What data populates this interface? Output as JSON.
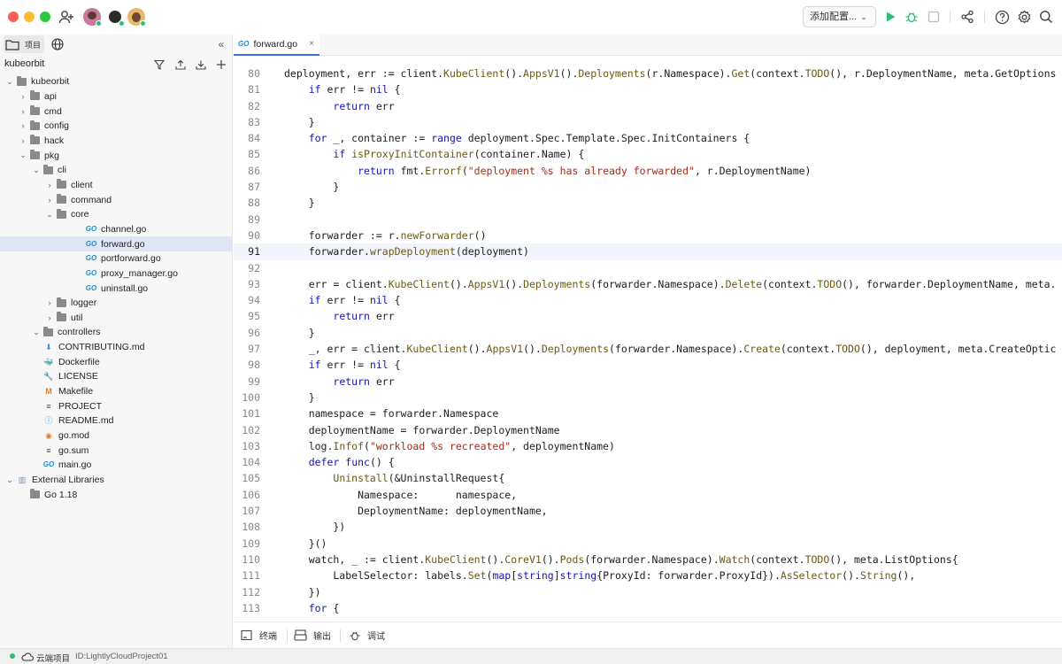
{
  "window": {
    "title": ""
  },
  "toolbar": {
    "run_config_label": "添加配置...",
    "icons": [
      "add-user-icon",
      "avatar-1",
      "avatar-2",
      "avatar-3",
      "run-icon",
      "debug-icon",
      "stop-icon",
      "share-icon",
      "help-icon",
      "settings-icon",
      "search-icon"
    ],
    "colors": {
      "run": "#2fbf71",
      "debug": "#2fbf71"
    }
  },
  "sidebar": {
    "tab_project": "项目",
    "project_name": "kubeorbit",
    "tree": [
      {
        "label": "kubeorbit",
        "depth": 0,
        "type": "folder",
        "open": true
      },
      {
        "label": "api",
        "depth": 1,
        "type": "folder",
        "open": false
      },
      {
        "label": "cmd",
        "depth": 1,
        "type": "folder",
        "open": false
      },
      {
        "label": "config",
        "depth": 1,
        "type": "folder",
        "open": false
      },
      {
        "label": "hack",
        "depth": 1,
        "type": "folder",
        "open": false
      },
      {
        "label": "pkg",
        "depth": 1,
        "type": "folder",
        "open": true
      },
      {
        "label": "cli",
        "depth": 2,
        "type": "folder",
        "open": true
      },
      {
        "label": "client",
        "depth": 3,
        "type": "folder",
        "open": false
      },
      {
        "label": "command",
        "depth": 3,
        "type": "folder",
        "open": false
      },
      {
        "label": "core",
        "depth": 3,
        "type": "folder",
        "open": true
      },
      {
        "label": "channel.go",
        "depth": 4,
        "type": "go"
      },
      {
        "label": "forward.go",
        "depth": 4,
        "type": "go",
        "selected": true
      },
      {
        "label": "portforward.go",
        "depth": 4,
        "type": "go"
      },
      {
        "label": "proxy_manager.go",
        "depth": 4,
        "type": "go"
      },
      {
        "label": "uninstall.go",
        "depth": 4,
        "type": "go"
      },
      {
        "label": "logger",
        "depth": 3,
        "type": "folder",
        "open": false
      },
      {
        "label": "util",
        "depth": 3,
        "type": "folder",
        "open": false
      },
      {
        "label": "controllers",
        "depth": 2,
        "type": "folder",
        "open": true
      },
      {
        "label": "CONTRIBUTING.md",
        "depth": 2,
        "type": "md-down"
      },
      {
        "label": "Dockerfile",
        "depth": 2,
        "type": "docker"
      },
      {
        "label": "LICENSE",
        "depth": 2,
        "type": "license"
      },
      {
        "label": "Makefile",
        "depth": 2,
        "type": "make"
      },
      {
        "label": "PROJECT",
        "depth": 2,
        "type": "text"
      },
      {
        "label": "README.md",
        "depth": 2,
        "type": "info"
      },
      {
        "label": "go.mod",
        "depth": 2,
        "type": "rss"
      },
      {
        "label": "go.sum",
        "depth": 2,
        "type": "text"
      },
      {
        "label": "main.go",
        "depth": 2,
        "type": "go"
      },
      {
        "label": "External Libraries",
        "depth": 0,
        "type": "lib",
        "open": true
      },
      {
        "label": "Go 1.18",
        "depth": 1,
        "type": "folder",
        "nochev": true
      }
    ]
  },
  "editor": {
    "tab_label": "forward.go",
    "current_line": 91,
    "lines": [
      {
        "n": "80",
        "t": "deployment, err := client.KubeClient().AppsV1().Deployments(r.Namespace).Get(context.TODO(), r.DeploymentName, meta.GetOptions"
      },
      {
        "n": "81",
        "t": "    if err != nil {"
      },
      {
        "n": "82",
        "t": "        return err"
      },
      {
        "n": "83",
        "t": "    }"
      },
      {
        "n": "84",
        "t": "    for _, container := range deployment.Spec.Template.Spec.InitContainers {"
      },
      {
        "n": "85",
        "t": "        if isProxyInitContainer(container.Name) {"
      },
      {
        "n": "86",
        "t": "            return fmt.Errorf(\"deployment %s has already forwarded\", r.DeploymentName)"
      },
      {
        "n": "87",
        "t": "        }"
      },
      {
        "n": "88",
        "t": "    }"
      },
      {
        "n": "89",
        "t": ""
      },
      {
        "n": "90",
        "t": "    forwarder := r.newForwarder()"
      },
      {
        "n": "91",
        "t": "    forwarder.wrapDeployment(deployment)"
      },
      {
        "n": "92",
        "t": ""
      },
      {
        "n": "93",
        "t": "    err = client.KubeClient().AppsV1().Deployments(forwarder.Namespace).Delete(context.TODO(), forwarder.DeploymentName, meta."
      },
      {
        "n": "94",
        "t": "    if err != nil {"
      },
      {
        "n": "95",
        "t": "        return err"
      },
      {
        "n": "96",
        "t": "    }"
      },
      {
        "n": "97",
        "t": "    _, err = client.KubeClient().AppsV1().Deployments(forwarder.Namespace).Create(context.TODO(), deployment, meta.CreateOptic"
      },
      {
        "n": "98",
        "t": "    if err != nil {"
      },
      {
        "n": "99",
        "t": "        return err"
      },
      {
        "n": "100",
        "t": "    }"
      },
      {
        "n": "101",
        "t": "    namespace = forwarder.Namespace"
      },
      {
        "n": "102",
        "t": "    deploymentName = forwarder.DeploymentName"
      },
      {
        "n": "103",
        "t": "    log.Infof(\"workload %s recreated\", deploymentName)"
      },
      {
        "n": "104",
        "t": "    defer func() {"
      },
      {
        "n": "105",
        "t": "        Uninstall(&UninstallRequest{"
      },
      {
        "n": "106",
        "t": "            Namespace:      namespace,"
      },
      {
        "n": "107",
        "t": "            DeploymentName: deploymentName,"
      },
      {
        "n": "108",
        "t": "        })"
      },
      {
        "n": "109",
        "t": "    }()"
      },
      {
        "n": "110",
        "t": "    watch, _ := client.KubeClient().CoreV1().Pods(forwarder.Namespace).Watch(context.TODO(), meta.ListOptions{"
      },
      {
        "n": "111",
        "t": "        LabelSelector: labels.Set(map[string]string{ProxyId: forwarder.ProxyId}).AsSelector().String(),"
      },
      {
        "n": "112",
        "t": "    })"
      },
      {
        "n": "113",
        "t": "    for {"
      }
    ]
  },
  "bottom_panel": {
    "terminal": "终端",
    "output": "输出",
    "debug": "调试"
  },
  "status": {
    "project_label": "云端项目",
    "project_id": "ID:LightlyCloudProject01"
  }
}
